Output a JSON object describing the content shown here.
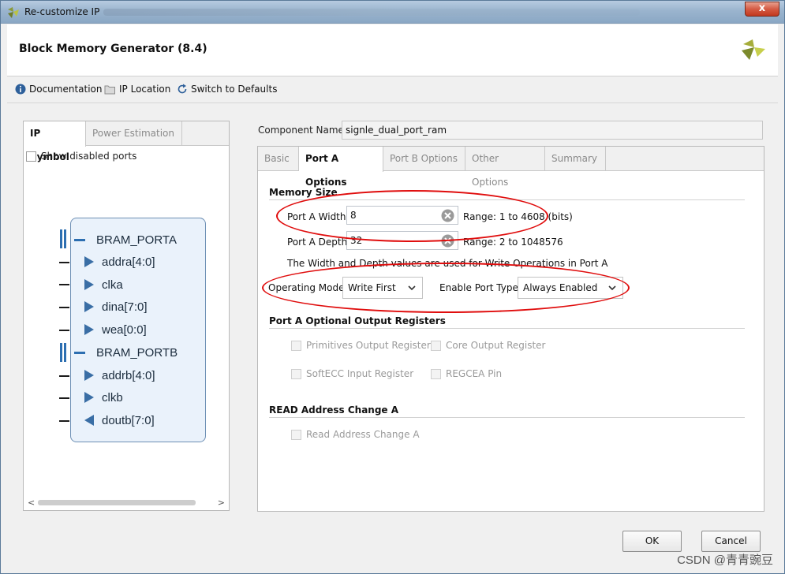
{
  "window": {
    "title": "Re-customize IP",
    "close_glyph": "x"
  },
  "header": {
    "title": "Block Memory Generator (8.4)"
  },
  "toolbar": {
    "documentation": "Documentation",
    "ip_location": "IP Location",
    "switch_defaults": "Switch to Defaults"
  },
  "left": {
    "tabs": [
      "IP Symbol",
      "Power Estimation"
    ],
    "show_disabled": "Show disabled ports",
    "ports": {
      "porta": "BRAM_PORTA",
      "addra": "addra[4:0]",
      "clka": "clka",
      "dina": "dina[7:0]",
      "wea": "wea[0:0]",
      "portb": "BRAM_PORTB",
      "addrb": "addrb[4:0]",
      "clkb": "clkb",
      "doutb": "doutb[7:0]"
    },
    "scroll_left": "<",
    "scroll_right": ">"
  },
  "component": {
    "label": "Component Name",
    "value": "signle_dual_port_ram"
  },
  "tabs": [
    "Basic",
    "Port A Options",
    "Port B Options",
    "Other Options",
    "Summary"
  ],
  "memory_size": {
    "title": "Memory Size",
    "width_label": "Port A Width",
    "width_value": "8",
    "width_range": "Range: 1 to 4608 (bits)",
    "depth_label": "Port A Depth",
    "depth_value": "32",
    "depth_range": "Range: 2 to 1048576",
    "note": "The Width and Depth values are used for Write Operations in Port A",
    "mode_label": "Operating Mode",
    "mode_value": "Write First",
    "enable_label": "Enable Port Type",
    "enable_value": "Always Enabled"
  },
  "output_regs": {
    "title": "Port A Optional Output Registers",
    "primitives": "Primitives Output Register",
    "core": "Core Output Register",
    "softecc": "SoftECC Input Register",
    "regcea": "REGCEA Pin"
  },
  "read_addr": {
    "title": "READ Address Change A",
    "option": "Read Address Change A"
  },
  "buttons": {
    "ok": "OK",
    "cancel": "Cancel"
  },
  "watermark": "CSDN @青青豌豆",
  "colors": {
    "annotation": "#e00d0d",
    "symbol_fill": "#eaf2fb",
    "port_arrow": "#3a6ea5"
  }
}
